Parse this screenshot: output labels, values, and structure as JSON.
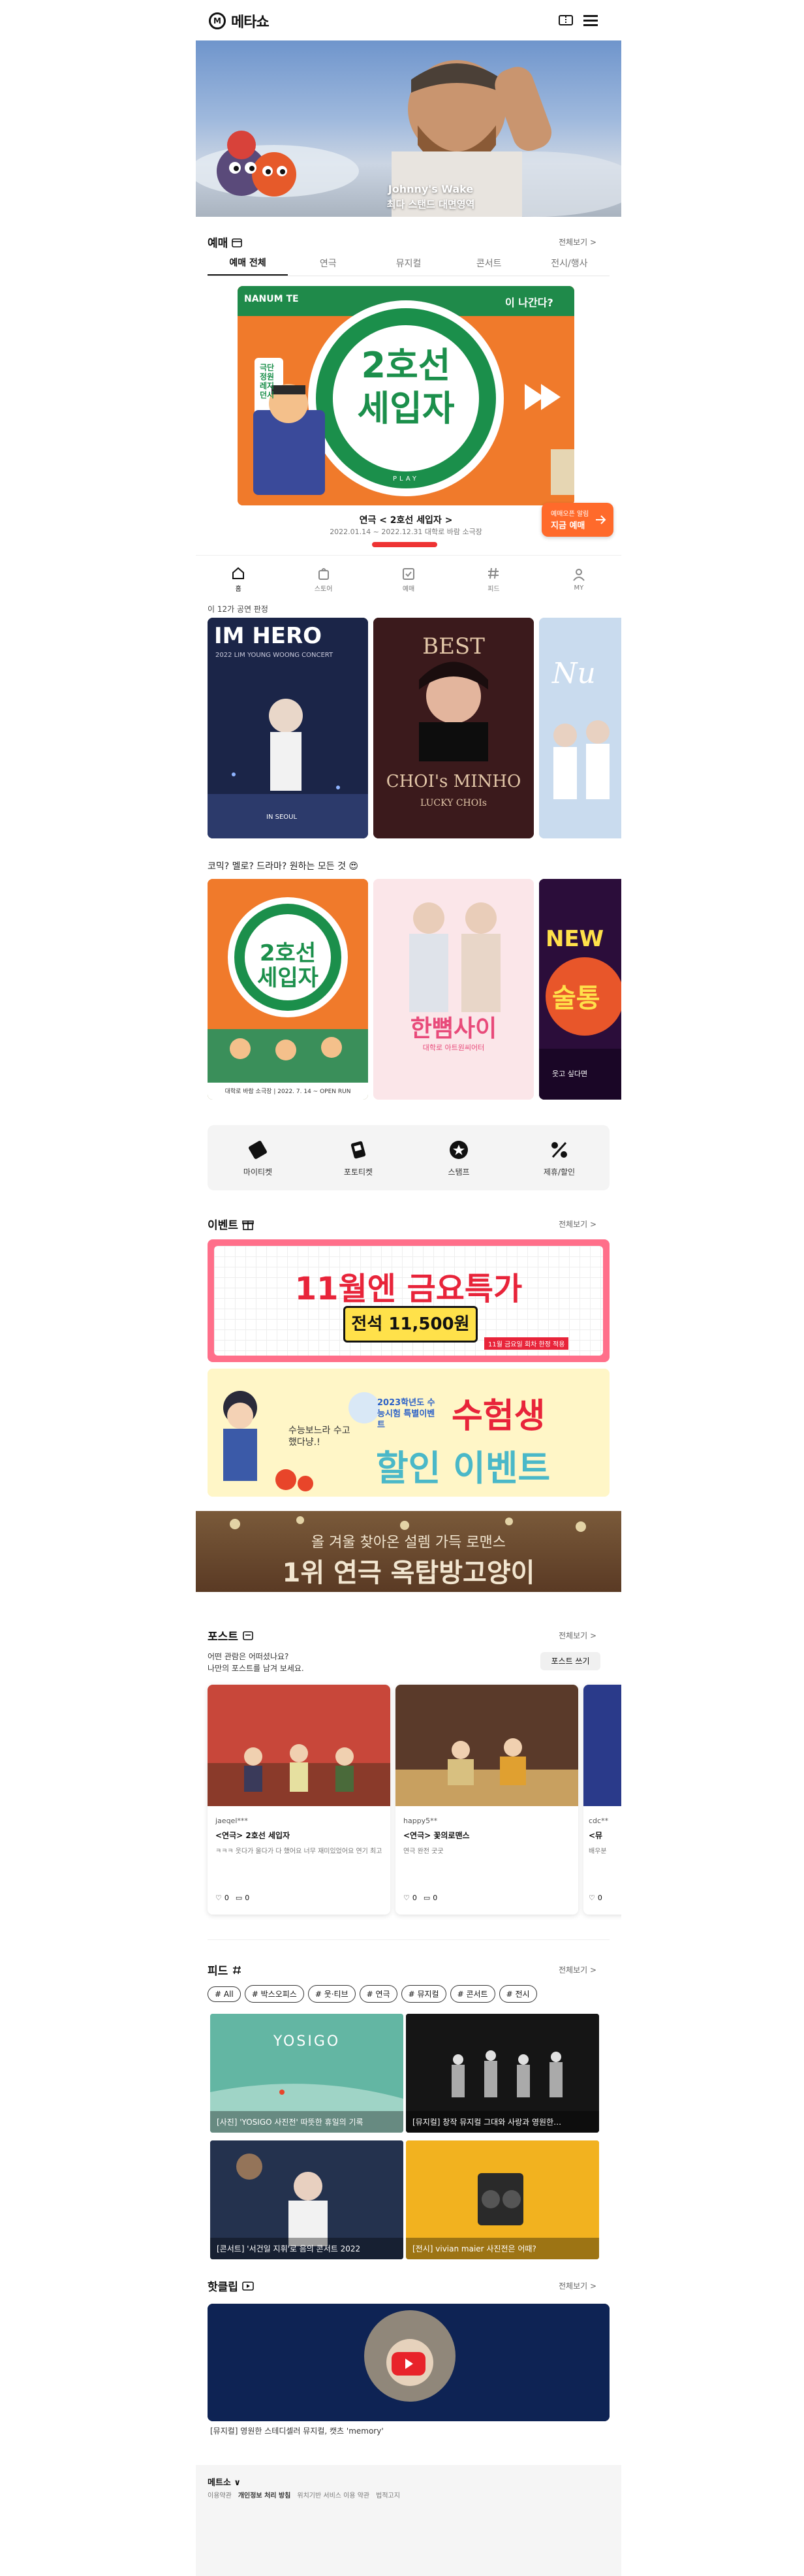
{
  "header": {
    "logo_text": "메타쇼",
    "logo_mark": "M"
  },
  "hero": {
    "line1": "Johnny's Wake",
    "line2": "최다 스탠드 대면영역"
  },
  "booking": {
    "title": "예매",
    "more": "전체보기 >",
    "tabs": [
      "예매 전체",
      "연극",
      "뮤지컬",
      "콘서트",
      "전시/행사"
    ],
    "banner": {
      "top_text": "NANUM TE",
      "side_text": "이 나간다?",
      "big1": "2호선",
      "big2": "세입자",
      "side_label": "극단 정원 레지던시",
      "play": "PLAY",
      "caption_title": "연극 < 2호선 세입자 >",
      "caption_sub": "2022.01.14 ~ 2022.12.31 대학로 바람 소극장",
      "float_btn1": "예매오픈 알림",
      "float_btn2": "지금 예매"
    }
  },
  "bottom_nav": [
    {
      "label": "홈",
      "icon": "home-icon"
    },
    {
      "label": "스토어",
      "icon": "shopping-bag-icon"
    },
    {
      "label": "예매",
      "icon": "calendar-icon"
    },
    {
      "label": "피드",
      "icon": "hashtag-icon"
    },
    {
      "label": "MY",
      "icon": "user-icon"
    }
  ],
  "concerts": {
    "heading": "이 12가 공연 판정",
    "posters": [
      {
        "title": "IM HERO",
        "sub": "2022 LIM YOUNG WOONG CONCERT",
        "bottom": "IN SEOUL"
      },
      {
        "title": "BEST",
        "sub": "CHOI's MINHO",
        "bottom": "LUCKY CHOIs"
      },
      {
        "title": "Nu",
        "sub": "",
        "bottom": ""
      }
    ]
  },
  "genre": {
    "heading": "코믹? 멜로? 드라마? 원하는 모든 것 😍",
    "posters": [
      {
        "title1": "2호선",
        "title2": "세입자",
        "sub": "대학로 바람 소극장 | 2022. 7. 14 ~ OPEN RUN"
      },
      {
        "title1": "한뼘사이",
        "title2": "",
        "sub": "대학로 아트원씨어터"
      },
      {
        "title1": "NEW",
        "title2": "술통",
        "sub": "웃고 싶다면"
      }
    ]
  },
  "quick_menu": [
    {
      "label": "마이티켓",
      "icon": "ticket-icon"
    },
    {
      "label": "포토티켓",
      "icon": "photo-ticket-icon"
    },
    {
      "label": "스탬프",
      "icon": "stamp-icon"
    },
    {
      "label": "제휴/할인",
      "icon": "percent-icon"
    }
  ],
  "events": {
    "title": "이벤트",
    "more": "전체보기 >",
    "banners": [
      {
        "title": "11월엔 금요특가",
        "price": "전석 11,500원",
        "note": "11월 금요일 회차 한정 적용"
      },
      {
        "title": "수험생",
        "title2": "할인 이벤트",
        "sub": "2023학년도 수능시험 특별이벤트",
        "bubble": "수능보느라 수고했다냥.!"
      },
      {
        "line1": "올 겨울 찾아온 설렘 가득 로맨스",
        "line2": "1위 연극 옥탑방고양이"
      }
    ]
  },
  "post": {
    "title": "포스트",
    "more": "전체보기 >",
    "desc1": "어떤 관람은 어떠셨나요?",
    "desc2": "나만의 포스트를 남겨 보세요.",
    "write_btn": "포스트 쓰기",
    "cards": [
      {
        "user": "jaeqel***",
        "title": "<연극> 2호선 세입자",
        "body": "ㅋㅋㅋ 웃다가 울다가 다 했어요 너무 재미있었어요 연기 최고",
        "likes": "0",
        "comments": "0"
      },
      {
        "user": "happy5**",
        "title": "<연극> 꽃의로맨스",
        "body": "연극 완전 굿굿",
        "likes": "0",
        "comments": "0"
      },
      {
        "user": "cdc**",
        "title": "<뮤",
        "body": "배우분",
        "likes": "0",
        "comments": "0"
      }
    ]
  },
  "feed": {
    "title": "피드",
    "more": "전체보기 >",
    "chips": [
      "# All",
      "# 박스오피스",
      "# 웃·티브",
      "# 연극",
      "# 뮤지컬",
      "# 콘서트",
      "# 전시"
    ],
    "cards": [
      {
        "caption": "[사진] 'YOSIGO 사진전' 따뜻한 휴일의 기록",
        "overlay": "YOSIGO"
      },
      {
        "caption": "[뮤지컬] 창작 뮤지컬 그대와 사랑과 영원한…",
        "overlay": ""
      },
      {
        "caption": "[콘서트] '서건일 지휘'로 음의 콘서트 2022",
        "overlay": ""
      },
      {
        "caption": "[전시] vivian maier 사진전은 어때?",
        "overlay": ""
      }
    ]
  },
  "clip": {
    "title": "핫클립",
    "more": "전체보기 >",
    "caption": "[뮤지컬] 영원한 스테디셀러 뮤지컬, 캣츠 'memory'"
  },
  "footer": {
    "company": "메트소 ∨",
    "links": [
      "이용약관",
      "개인정보 처리 방침",
      "위치기반 서비스 이용 약관",
      "법적고지"
    ]
  }
}
